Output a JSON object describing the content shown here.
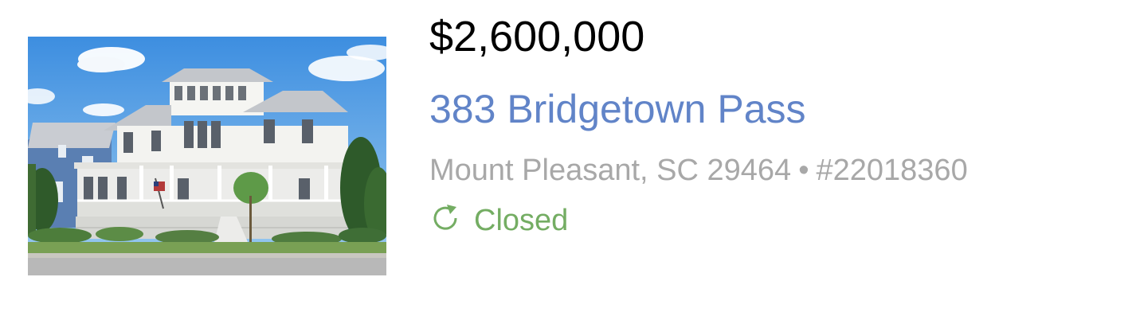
{
  "listing": {
    "price": "$2,600,000",
    "address": "383 Bridgetown Pass",
    "location": "Mount Pleasant, SC 29464",
    "separator": "•",
    "mls_number": "#22018360",
    "status": "Closed",
    "status_icon": "refresh-icon",
    "photo_subject": "house-photo"
  },
  "colors": {
    "address_link": "#6184c8",
    "meta_text": "#a8a8a8",
    "status_green": "#74ad63",
    "price_text": "#000000"
  }
}
